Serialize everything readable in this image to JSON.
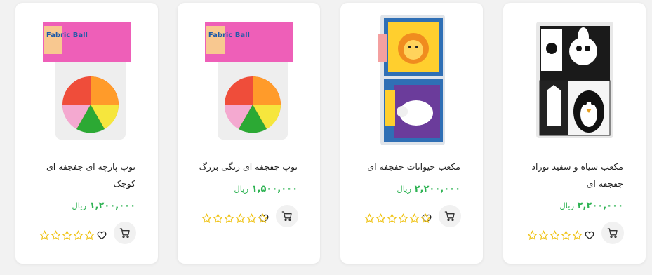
{
  "colors": {
    "price": "#2fb354",
    "star_outline": "#f0c419",
    "background": "#f2f2f2",
    "card": "#ffffff"
  },
  "products": [
    {
      "title": "مکعب سیاه و سفید نوزاد جفجفه ای",
      "price": "۲,۲۰۰,۰۰۰",
      "currency": "ریال",
      "rating": 0,
      "image": "black-white-baby-cubes"
    },
    {
      "title": "مکعب حیوانات جفجفه ای",
      "price": "۲,۲۰۰,۰۰۰",
      "currency": "ریال",
      "rating": 0,
      "image": "animal-cubes"
    },
    {
      "title": "توپ جفجفه ای رنگی بزرگ",
      "price": "۱,۵۰۰,۰۰۰",
      "currency": "ریال",
      "rating": 0,
      "image": "fabric-ball-large",
      "package_text": "Fabric Ball"
    },
    {
      "title": "توپ پارچه ای جفجفه ای کوچک",
      "price": "۱,۲۰۰,۰۰۰",
      "currency": "ریال",
      "rating": 0,
      "image": "fabric-ball-small",
      "package_text": "Fabric Ball"
    }
  ]
}
